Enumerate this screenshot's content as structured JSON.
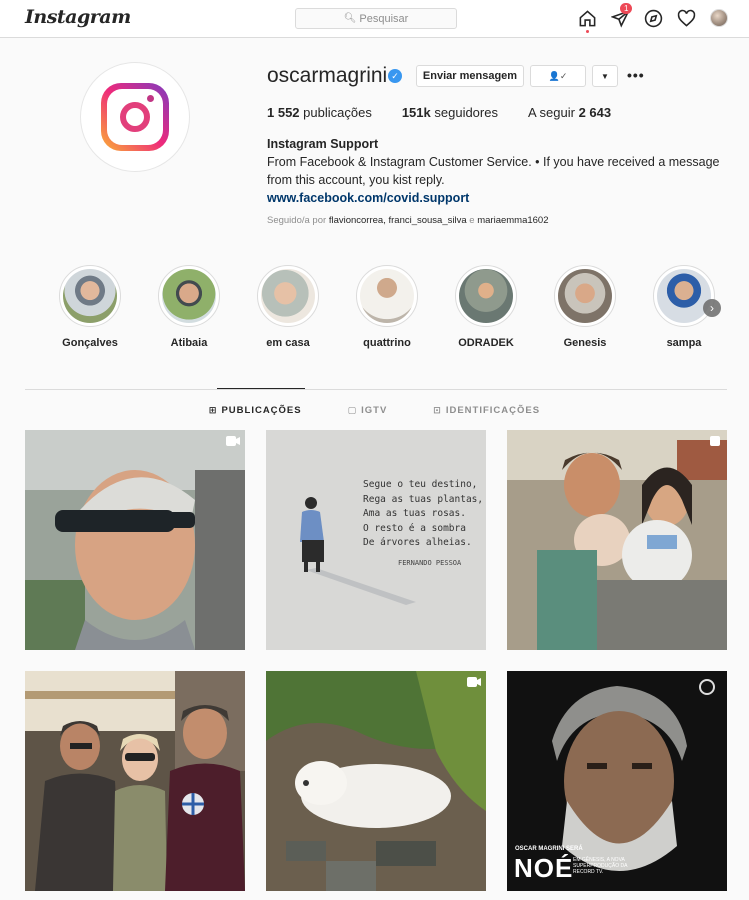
{
  "header": {
    "logo": "Instagram",
    "search_placeholder": "Pesquisar",
    "activity_badge": "1"
  },
  "profile": {
    "username": "oscarmagrini",
    "verified_mark": "✓",
    "message_button": "Enviar mensagem",
    "following_button": "👤✓",
    "dropdown": "▼",
    "more": "•••",
    "stats": {
      "posts_count": "1 552",
      "posts_label": "publicações",
      "followers_count": "151k",
      "followers_label": "seguidores",
      "following_label": "A seguir",
      "following_count": "2 643"
    },
    "bio": {
      "name": "Instagram Support",
      "text": "From Facebook & Instagram Customer Service. • If you have received a message from this account, you kist reply.",
      "link": "www.facebook.com/covid.support"
    },
    "followed_by": {
      "prefix": "Seguido/a por",
      "names": "flavioncorrea, franci_sousa_silva",
      "joiner": "e",
      "last": "mariaemma1602"
    }
  },
  "highlights": [
    {
      "label": "Gonçalves"
    },
    {
      "label": "Atibaia"
    },
    {
      "label": "em casa"
    },
    {
      "label": "quattrino"
    },
    {
      "label": "ODRADEK"
    },
    {
      "label": "Genesis"
    },
    {
      "label": "sampa"
    }
  ],
  "highlights_next": "›",
  "tabs": [
    {
      "icon": "⊞",
      "label": "PUBLICAÇÕES"
    },
    {
      "icon": "▢",
      "label": "IGTV"
    },
    {
      "icon": "⊡",
      "label": "IDENTIFICAÇÕES"
    }
  ],
  "posts": {
    "quote_lines": [
      "Segue o teu destino,",
      "Rega as tuas plantas,",
      "Ama as tuas rosas.",
      "O resto é a sombra",
      "De árvores alheias."
    ],
    "quote_author": "FERNANDO PESSOA",
    "poster_small": "OSCAR MAGRINI SERÁ",
    "poster_title": "NOÉ",
    "poster_caption": "EM GÊNESIS, A NOVA SUPERPRODUÇÃO DA RECORD TV."
  },
  "colors": {
    "accent_link": "#00376b",
    "verified_blue": "#3897f0",
    "notification_red": "#ed4956"
  }
}
